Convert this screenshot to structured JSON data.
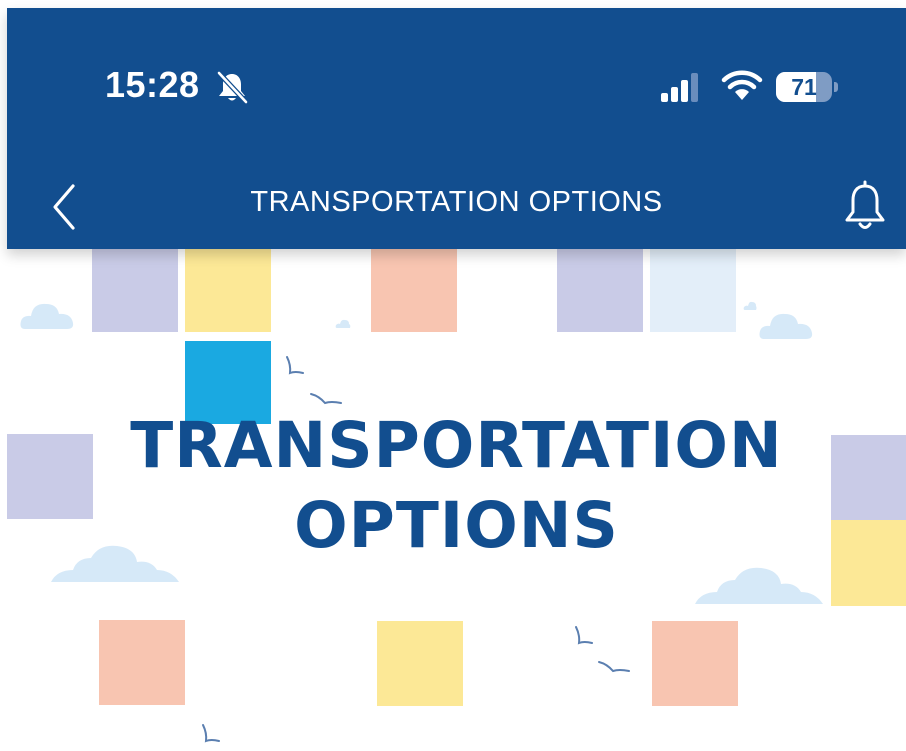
{
  "status_bar": {
    "time": "15:28",
    "battery_level": "71",
    "icons": [
      "bell-slash-icon",
      "cellular-signal-icon",
      "wifi-icon",
      "battery-icon"
    ]
  },
  "nav": {
    "title": "TRANSPORTATION OPTIONS",
    "back_icon": "chevron-left-icon",
    "notification_icon": "bell-icon"
  },
  "banner": {
    "title_line1": "TRANSPORTATION",
    "title_line2": "OPTIONS"
  },
  "colors": {
    "header_bg": "#124e8f",
    "title_text": "#124e8f",
    "tile_lavender": "#c9cbe7",
    "tile_yellow": "#fce896",
    "tile_peach": "#f8c5b1",
    "tile_blue": "#1aa9e1",
    "tile_pale_blue": "#e3eef9",
    "cloud": "#d6e9f8"
  }
}
